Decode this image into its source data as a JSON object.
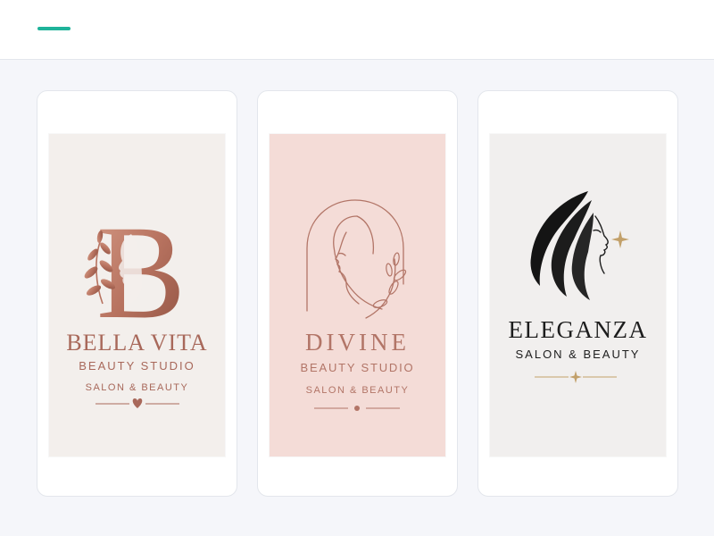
{
  "header": {
    "accent_color": "#1fb39a"
  },
  "cards": [
    {
      "logo_image": "bella-vita-logo",
      "letter": "B",
      "brand": "BELLA VITA",
      "subtitle": "BEAUTY STUDIO",
      "tagline": "SALON & BEAUTY",
      "background": "#f3efec",
      "accent": "#a8685a"
    },
    {
      "logo_image": "divine-logo",
      "brand": "DIVINE",
      "subtitle": "BEAUTY STUDIO",
      "tagline": "SALON & BEAUTY",
      "background": "#f4dcd7",
      "accent": "#b27567"
    },
    {
      "logo_image": "eleganza-logo",
      "brand": "ELEGANZA",
      "subtitle": "SALON & BEAUTY",
      "background": "#f1efee",
      "accent": "#1d1d1d",
      "sparkle_color": "#c2a06a"
    }
  ]
}
